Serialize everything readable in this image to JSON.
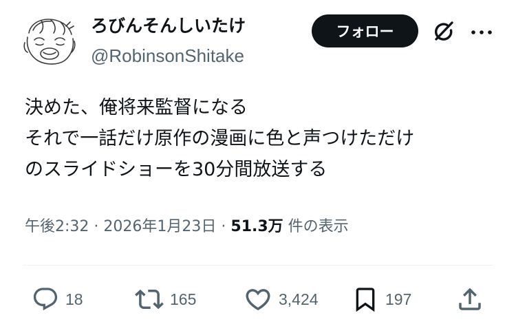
{
  "user": {
    "display_name": "ろびんそんしいたけ",
    "handle": "@RobinsonShitake"
  },
  "follow_label": "フォロー",
  "tweet": {
    "lines": [
      "決めた、俺将来監督になる",
      "それで一話だけ原作の漫画に色と声つけただけ",
      "のスライドショーを30分間放送する"
    ]
  },
  "meta": {
    "time": "午後2:32",
    "separator": "·",
    "date": "2026年1月23日",
    "views_count": "51.3万",
    "views_label": "件の表示"
  },
  "actions": {
    "replies": "18",
    "reposts": "165",
    "likes": "3,424",
    "bookmarks": "197"
  },
  "icons": {
    "reply": "reply-icon",
    "repost": "repost-icon",
    "like": "heart-icon",
    "bookmark": "bookmark-icon",
    "share": "share-icon",
    "grok": "grok-icon",
    "more": "more-icon"
  },
  "colors": {
    "text": "#0f1419",
    "secondary": "#536471",
    "follow_bg": "#0f1419",
    "follow_text": "#ffffff"
  }
}
